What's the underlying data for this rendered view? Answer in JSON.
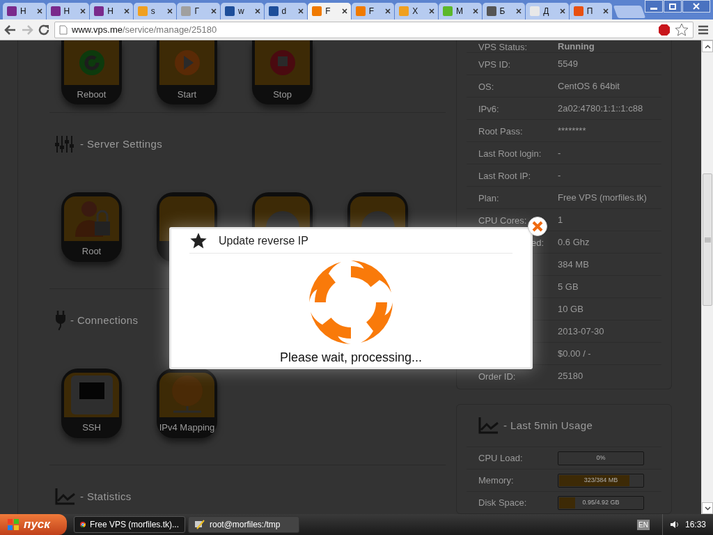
{
  "browser": {
    "tabs": [
      {
        "title": "H",
        "selected": false,
        "color": "#7a2a8c"
      },
      {
        "title": "H",
        "selected": false,
        "color": "#7a2a8c"
      },
      {
        "title": "H",
        "selected": false,
        "color": "#7a2a8c"
      },
      {
        "title": "s",
        "selected": false,
        "color": "#f0a020"
      },
      {
        "title": "Г",
        "selected": false,
        "color": "#a0a0a0"
      },
      {
        "title": "w",
        "selected": false,
        "color": "#1d4e9a"
      },
      {
        "title": "d",
        "selected": false,
        "color": "#1d4e9a"
      },
      {
        "title": "F",
        "selected": true,
        "color": "#f07a00"
      },
      {
        "title": "F",
        "selected": false,
        "color": "#f07a00"
      },
      {
        "title": "X",
        "selected": false,
        "color": "#f0a020"
      },
      {
        "title": "M",
        "selected": false,
        "color": "#5cb82a"
      },
      {
        "title": "Б",
        "selected": false,
        "color": "#555555"
      },
      {
        "title": "Д",
        "selected": false,
        "color": "#e8e8e8"
      },
      {
        "title": "П",
        "selected": false,
        "color": "#e85010"
      }
    ],
    "address": {
      "host": "www.vps.me",
      "path": "/service/manage/25180"
    }
  },
  "actions": [
    {
      "label": "Reboot",
      "kind": "reboot"
    },
    {
      "label": "Start",
      "kind": "start"
    },
    {
      "label": "Stop",
      "kind": "stop"
    }
  ],
  "sections": [
    {
      "title": "- Server Settings",
      "kind": "settings",
      "tiles": [
        {
          "label": "Root",
          "kind": "root"
        },
        {
          "kind": "blank"
        },
        {
          "kind": "mouse"
        },
        {
          "kind": "arrow"
        }
      ]
    },
    {
      "title": "- Connections",
      "kind": "connections",
      "tiles": [
        {
          "label": "SSH",
          "kind": "ssh"
        },
        {
          "label": "IPv4 Mapping",
          "kind": "ipv4"
        }
      ]
    },
    {
      "title": "- Statistics",
      "kind": "statistics"
    }
  ],
  "server_info": [
    {
      "label": "VPS Status:",
      "value": "Running",
      "bold": true
    },
    {
      "label": "VPS ID:",
      "value": "5549"
    },
    {
      "label": "OS:",
      "value": "CentOS 6 64bit"
    },
    {
      "label": "IPv6:",
      "value": "2a02:4780:1:1::1:c88"
    },
    {
      "label": "Root Pass:",
      "value": "********"
    },
    {
      "label": "Last Root login:",
      "value": "-"
    },
    {
      "label": "Last Root IP:",
      "value": "-"
    },
    {
      "label": "Plan:",
      "value": "Free VPS (morfiles.tk)"
    },
    {
      "label": "CPU Cores:",
      "value": "1"
    },
    {
      "label": "ed:",
      "value": "0.6 Ghz",
      "cut": true
    },
    {
      "value": "384 MB"
    },
    {
      "value": "5 GB"
    },
    {
      "value": "10 GB"
    },
    {
      "value": "2013-07-30"
    },
    {
      "value": "$0.00 / -"
    },
    {
      "label": "Order ID:",
      "value": "25180"
    }
  ],
  "usage": {
    "title": "- Last 5min Usage",
    "rows": [
      {
        "label": "CPU Load:",
        "reading": "0%",
        "level": 0
      },
      {
        "label": "Memory:",
        "reading": "323/384 MB",
        "level": 0.84
      },
      {
        "label": "Disk Space:",
        "reading": "0.95/4.92 GB",
        "level": 0.19
      }
    ]
  },
  "dialog": {
    "title": "Update reverse IP",
    "message": "Please wait, processing..."
  },
  "taskbar": {
    "start": "пуск",
    "tasks": [
      {
        "title": "Free VPS (morfiles.tk)...",
        "selected": true,
        "kind": "browser"
      },
      {
        "title": "root@morfiles:/tmp",
        "selected": false,
        "kind": "terminal"
      }
    ],
    "language": "EN",
    "clock": "16:33"
  }
}
